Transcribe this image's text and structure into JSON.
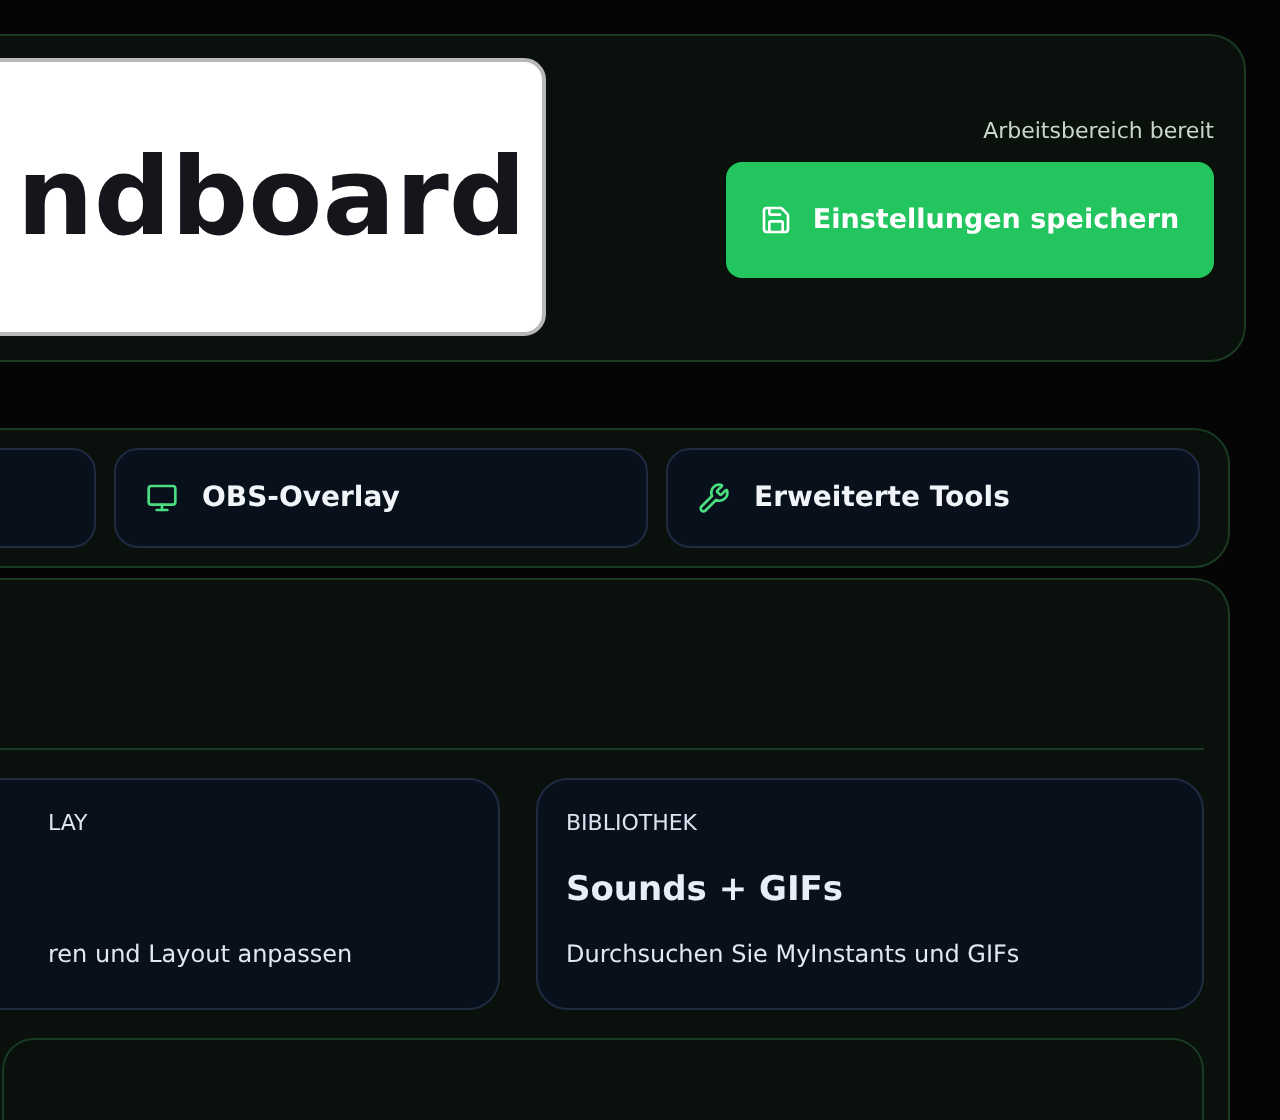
{
  "header": {
    "logo_text": "ndboard",
    "status": "Arbeitsbereich bereit",
    "save_button": "Einstellungen speichern"
  },
  "tabs": [
    {
      "kind": "cut"
    },
    {
      "kind": "monitor",
      "label": "OBS-Overlay"
    },
    {
      "kind": "wrench",
      "label": "Erweiterte Tools"
    }
  ],
  "cards": [
    {
      "eyebrow": "LAY",
      "description": "ren und Layout anpassen"
    },
    {
      "eyebrow": "BIBLIOTHEK",
      "title": "Sounds + GIFs",
      "description": "Durchsuchen Sie MyInstants und GIFs"
    }
  ]
}
